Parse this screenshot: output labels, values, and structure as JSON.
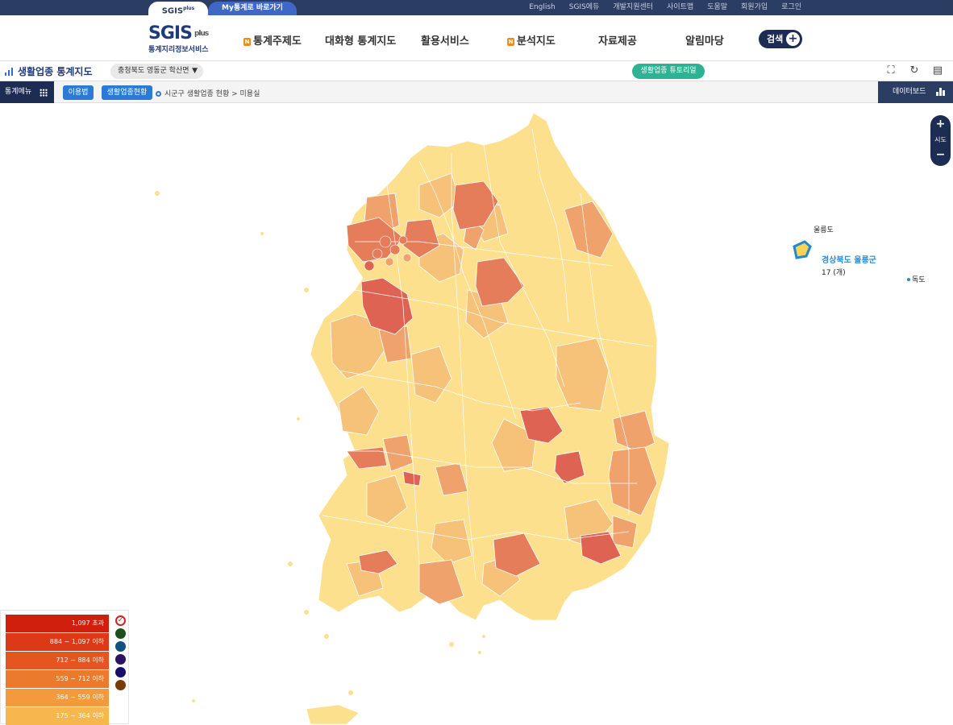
{
  "top_bar": {
    "tab_sgis": "SGIS",
    "tab_sgis_sup": "plus",
    "tab_my": "My통계로 바로가기",
    "links": [
      "English",
      "SGIS에듀",
      "개발지원센터",
      "사이트맵",
      "도움말",
      "회원가입",
      "로그인"
    ]
  },
  "header": {
    "logo_main": "SGIS",
    "logo_sup": "plus",
    "logo_sub": "통계지리정보서비스",
    "nav": [
      {
        "label": "통계주제도",
        "badge": "N"
      },
      {
        "label": "대화형 통계지도",
        "badge": ""
      },
      {
        "label": "활용서비스",
        "badge": ""
      },
      {
        "label": "분석지도",
        "badge": "N"
      },
      {
        "label": "자료제공",
        "badge": ""
      },
      {
        "label": "알림마당",
        "badge": ""
      }
    ],
    "search_label": "검색"
  },
  "title_bar": {
    "title": "생활업종 통계지도",
    "region": "충청북도 영동군 학산면",
    "tutorial": "생활업종 튜토리얼"
  },
  "menu_bar": {
    "menu_label": "통계메뉴",
    "usage_btn": "이용법",
    "status_btn": "생활업종현황",
    "breadcrumb": "시군구 생활업종 현황 > 미용실",
    "dashboard_label": "데이터보드"
  },
  "zoom": {
    "plus": "+",
    "level": "시도",
    "minus": "−"
  },
  "map_labels": {
    "ulleungdo": "울릉도",
    "ulleung_region": "경상북도 울릉군",
    "ulleung_value": "17 (개)",
    "dokdo": "독도"
  },
  "legend": {
    "rows": [
      {
        "label": "1,097 초과",
        "color": "#d11f0e"
      },
      {
        "label": "884 ~ 1,097 이하",
        "color": "#dc3a16"
      },
      {
        "label": "712 ~ 884 이하",
        "color": "#e3561f"
      },
      {
        "label": "559 ~ 712 이하",
        "color": "#eb7a2c"
      },
      {
        "label": "364 ~ 559 이하",
        "color": "#f29a3d"
      },
      {
        "label": "175 ~ 364 이하",
        "color": "#f6b74f"
      }
    ],
    "palette": [
      {
        "name": "red-palette",
        "color": "#d81e1e"
      },
      {
        "name": "green-palette",
        "color": "#1c4f1c"
      },
      {
        "name": "blue-palette",
        "color": "#12517f"
      },
      {
        "name": "purple-palette",
        "color": "#2c1262"
      },
      {
        "name": "navy-palette",
        "color": "#150f6b"
      },
      {
        "name": "brown-palette",
        "color": "#7a3a08"
      }
    ]
  },
  "map_colors": {
    "base": "#fde08e",
    "light": "#f6c27a",
    "mid": "#efa26c",
    "dark": "#e67d5a",
    "darkest": "#df6352",
    "ulleung_fill": "#f7d35a",
    "ulleung_stroke": "#1f8ad1"
  }
}
